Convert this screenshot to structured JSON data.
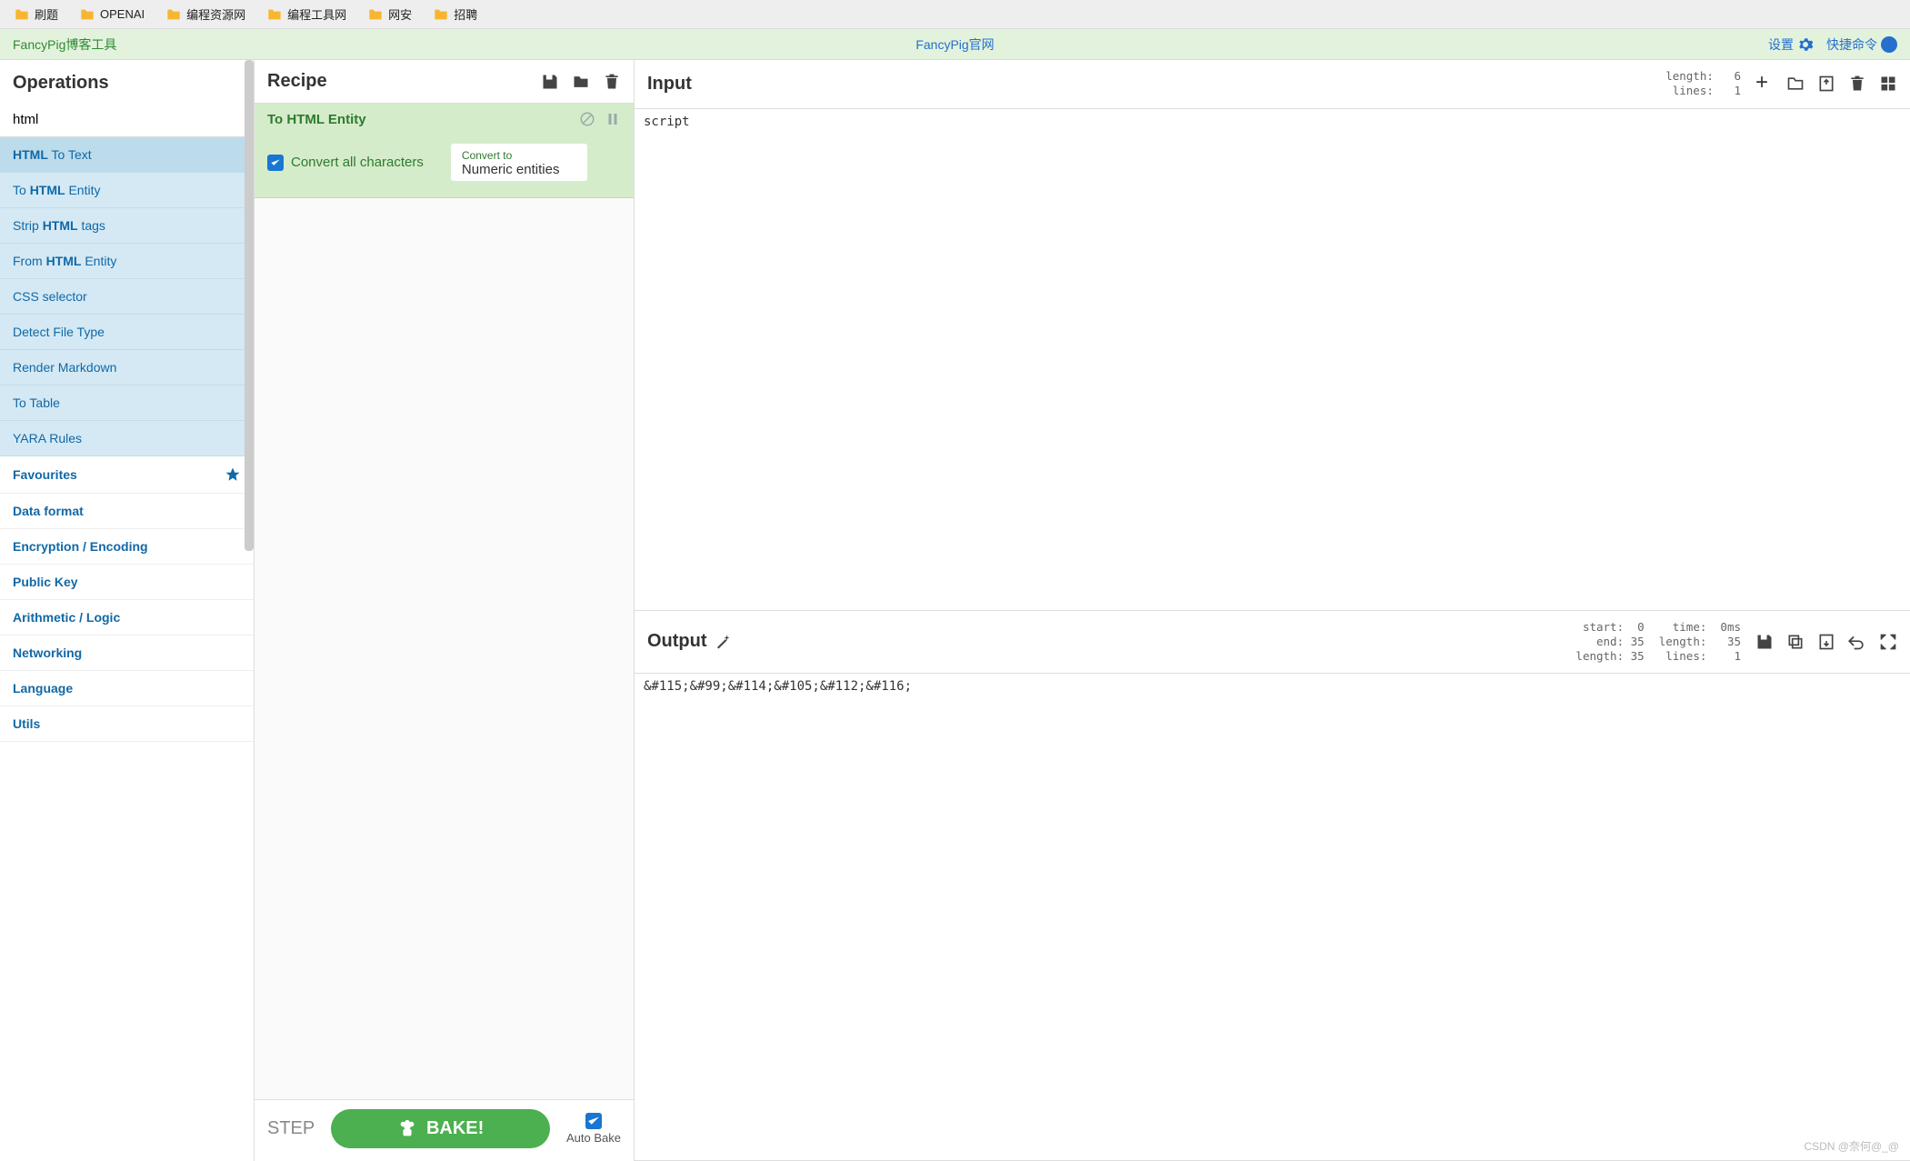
{
  "bookmarks": [
    "刷题",
    "OPENAI",
    "编程资源网",
    "编程工具网",
    "网安",
    "招聘"
  ],
  "banner": {
    "left": "FancyPig博客工具",
    "center": "FancyPig官网",
    "settings": "设置",
    "shortcuts": "快捷命令"
  },
  "ops": {
    "title": "Operations",
    "search": "html",
    "items": [
      {
        "pre": "",
        "b": "HTML",
        "post": " To Text",
        "sel": true
      },
      {
        "pre": "To ",
        "b": "HTML",
        "post": " Entity"
      },
      {
        "pre": "Strip ",
        "b": "HTML",
        "post": " tags"
      },
      {
        "pre": "From ",
        "b": "HTML",
        "post": " Entity"
      },
      {
        "pre": "CSS selector",
        "b": "",
        "post": ""
      },
      {
        "pre": "Detect File Type",
        "b": "",
        "post": ""
      },
      {
        "pre": "Render Markdown",
        "b": "",
        "post": ""
      },
      {
        "pre": "To Table",
        "b": "",
        "post": ""
      },
      {
        "pre": "YARA Rules",
        "b": "",
        "post": ""
      }
    ],
    "cats": [
      "Favourites",
      "Data format",
      "Encryption / Encoding",
      "Public Key",
      "Arithmetic / Logic",
      "Networking",
      "Language",
      "Utils"
    ]
  },
  "recipe": {
    "title": "Recipe",
    "op_title": "To HTML Entity",
    "chk_label": "Convert all characters",
    "select_label": "Convert to",
    "select_value": "Numeric entities",
    "step": "STEP",
    "bake": "BAKE!",
    "autobake": "Auto Bake"
  },
  "input": {
    "title": "Input",
    "stats": "length:   6\nlines:   1",
    "content": "script"
  },
  "output": {
    "title": "Output",
    "stats_left": " start:  0\n   end: 35\nlength: 35",
    "stats_right": "  time:  0ms\nlength:   35\n lines:    1",
    "content": "&#115;&#99;&#114;&#105;&#112;&#116;"
  },
  "watermark": "CSDN @奈何@_@"
}
